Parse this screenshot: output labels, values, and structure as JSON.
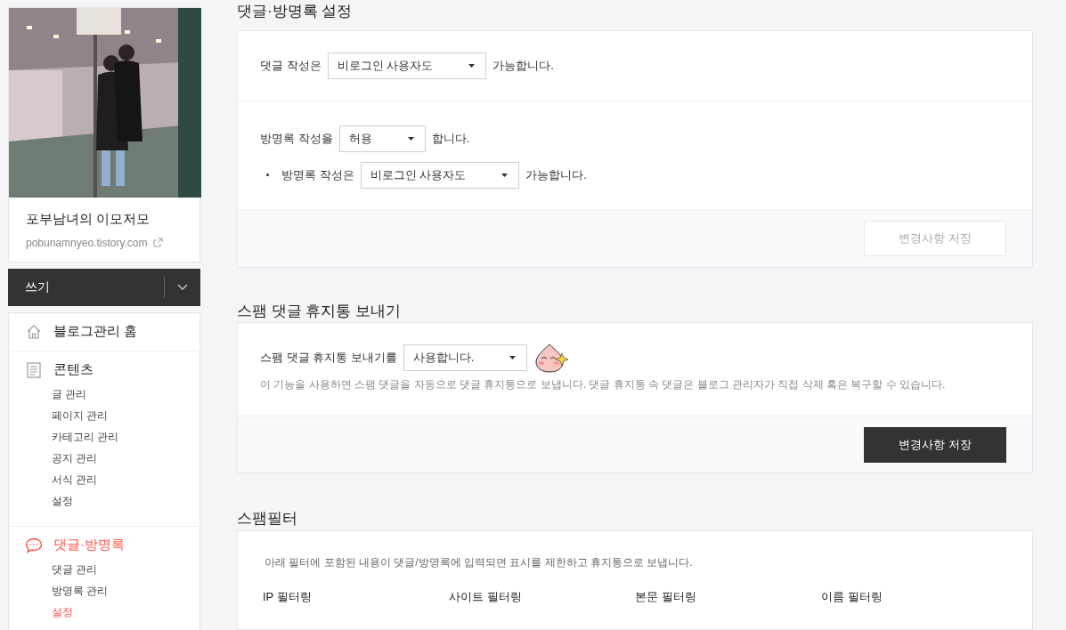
{
  "blog": {
    "name": "포부남녀의 이모저모",
    "url": "pobunamnyeo.tistory.com"
  },
  "write_button": {
    "label": "쓰기"
  },
  "menu": [
    {
      "label": "블로그관리 홈",
      "kind": "home",
      "selected": false
    },
    {
      "label": "콘텐츠",
      "kind": "document",
      "selected": false,
      "children": [
        {
          "label": "글 관리",
          "selected": false
        },
        {
          "label": "페이지 관리",
          "selected": false
        },
        {
          "label": "카테고리 관리",
          "selected": false
        },
        {
          "label": "공지 관리",
          "selected": false
        },
        {
          "label": "서식 관리",
          "selected": false
        },
        {
          "label": "설정",
          "selected": false
        }
      ]
    },
    {
      "label": "댓글·방명록",
      "kind": "comment",
      "selected": true,
      "children": [
        {
          "label": "댓글 관리",
          "selected": false
        },
        {
          "label": "방명록 관리",
          "selected": false
        },
        {
          "label": "설정",
          "selected": true
        }
      ]
    }
  ],
  "comment_settings": {
    "title": "댓글·방명록 설정",
    "blocks": [
      [
        {
          "label": "댓글 작성은",
          "value": "비로그인 사용자도",
          "suffix": "가능합니다.",
          "bulleted": false
        }
      ],
      [
        {
          "label": "방명록 작성을",
          "value": "허용",
          "suffix": "합니다.",
          "bulleted": false
        },
        {
          "label": "방명록 작성은",
          "value": "비로그인 사용자도",
          "suffix": "가능합니다.",
          "bulleted": true
        }
      ]
    ],
    "save_button": {
      "label": "변경사항 저장",
      "disabled": true
    }
  },
  "spam_trash": {
    "title": "스팸 댓글 휴지통 보내기",
    "label": "스팸 댓글 휴지통 보내기를",
    "value": "사용합니다.",
    "description": "이 기능을 사용하면 스팸 댓글을 자동으로 댓글 휴지통으로 보냅니다. 댓글 휴지통 속 댓글은 블로그 관리자가 직접 삭제 혹은 복구할 수 있습니다.",
    "save_button": {
      "label": "변경사항 저장",
      "disabled": false
    }
  },
  "spam_filter": {
    "title": "스팸필터",
    "description": "아래 필터에 포함된 내용이 댓글/방명록에 입력되면 표시를 제한하고 휴지통으로 보냅니다.",
    "columns": [
      "IP 필터링",
      "사이트 필터링",
      "본문 필터링",
      "이름 필터링"
    ]
  }
}
